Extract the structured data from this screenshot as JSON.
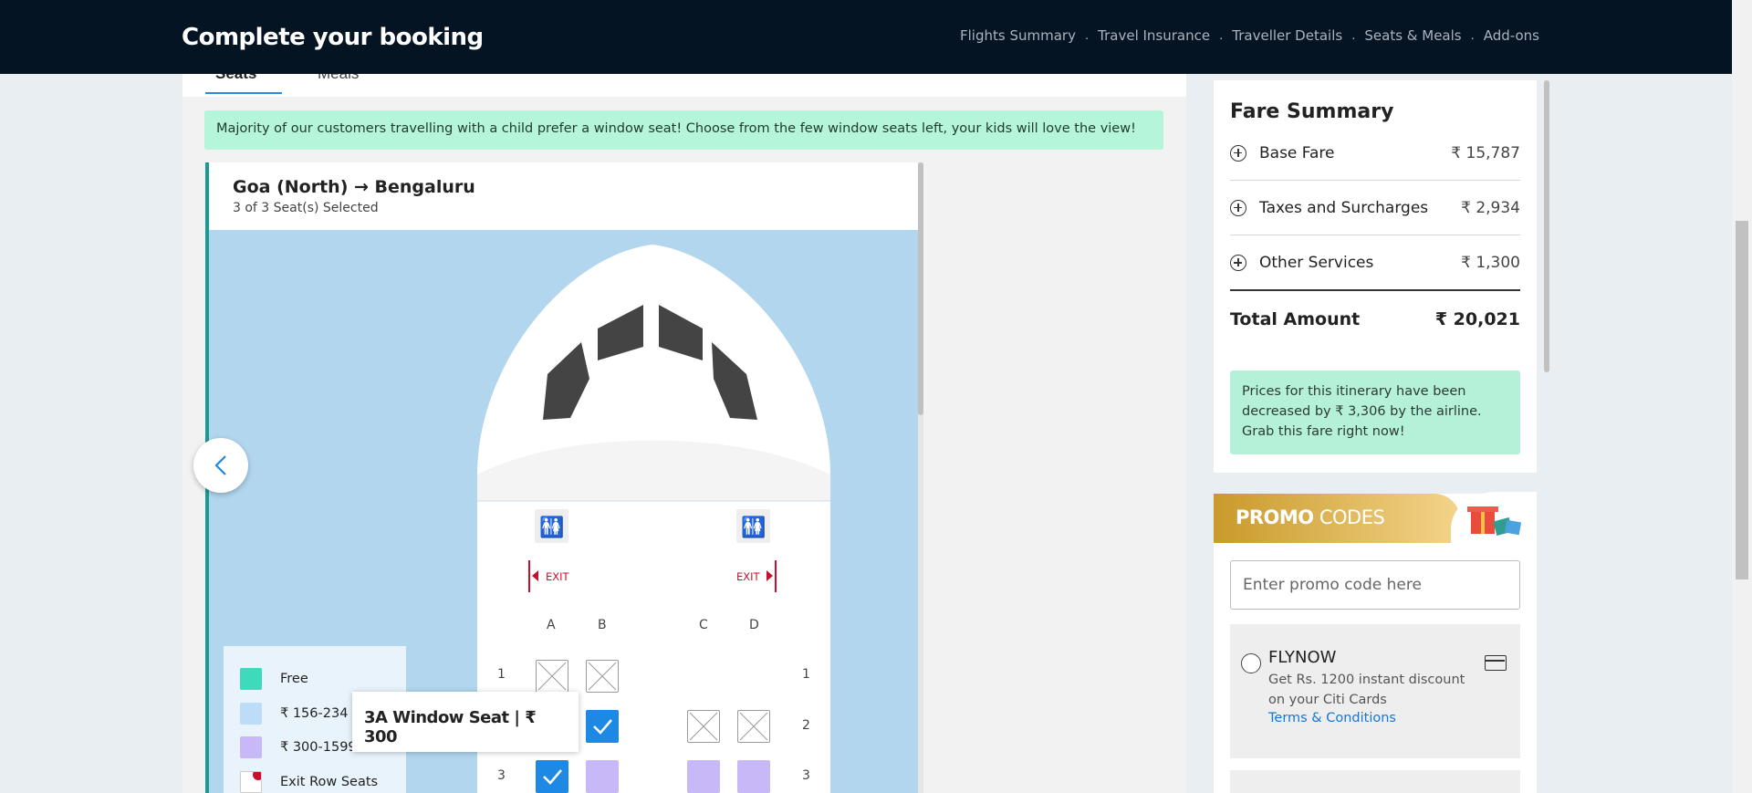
{
  "header": {
    "title": "Complete your booking",
    "steps": [
      "Flights Summary",
      "Travel Insurance",
      "Traveller Details",
      "Seats & Meals",
      "Add-ons"
    ]
  },
  "tabs": {
    "seats": "Seats",
    "meals": "Meals"
  },
  "banner": "Majority of our customers travelling with a child prefer a window seat! Choose from the few window seats left, your kids will love the view!",
  "seat_map": {
    "route": "Goa (North) → Bengaluru",
    "selected_text": "3 of 3 Seat(s) Selected",
    "exit_label": "EXIT",
    "columns": [
      "A",
      "B",
      "C",
      "D"
    ],
    "rows": [
      "1",
      "2",
      "3"
    ],
    "tooltip": "3A Window Seat | ₹ 300"
  },
  "legend": {
    "free": "Free",
    "range1": "₹ 156-234",
    "range2": "₹ 300-1599",
    "exit_row": "Exit Row Seats"
  },
  "fare_summary": {
    "title": "Fare Summary",
    "rows": [
      {
        "label": "Base Fare",
        "amount": "₹ 15,787"
      },
      {
        "label": "Taxes and Surcharges",
        "amount": "₹ 2,934"
      },
      {
        "label": "Other Services",
        "amount": "₹ 1,300"
      }
    ],
    "total_label": "Total Amount",
    "total_amount": "₹ 20,021",
    "notice": "Prices for this itinerary have been decreased by ₹ 3,306 by the airline. Grab this fare right now!"
  },
  "promo": {
    "title_bold": "PROMO",
    "title_rest": " CODES",
    "placeholder": "Enter promo code here",
    "offers": [
      {
        "code": "FLYNOW",
        "desc": "Get Rs. 1200 instant discount on your Citi Cards",
        "link": "Terms & Conditions"
      }
    ]
  },
  "colors": {
    "header_bg": "#051423",
    "free": "#3ddbbc",
    "range1": "#bcdcf8",
    "range2": "#c8b8f8",
    "selected": "#1e88e5",
    "exit": "#c8102e"
  }
}
